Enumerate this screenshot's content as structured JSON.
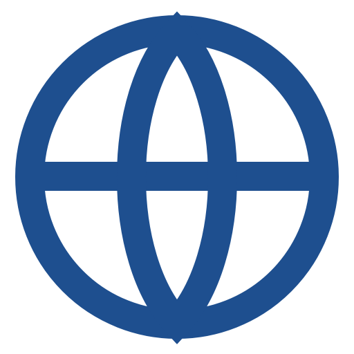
{
  "icon": {
    "name": "globe-icon",
    "color": "#1E4F8F",
    "background": "#FFFFFF"
  }
}
